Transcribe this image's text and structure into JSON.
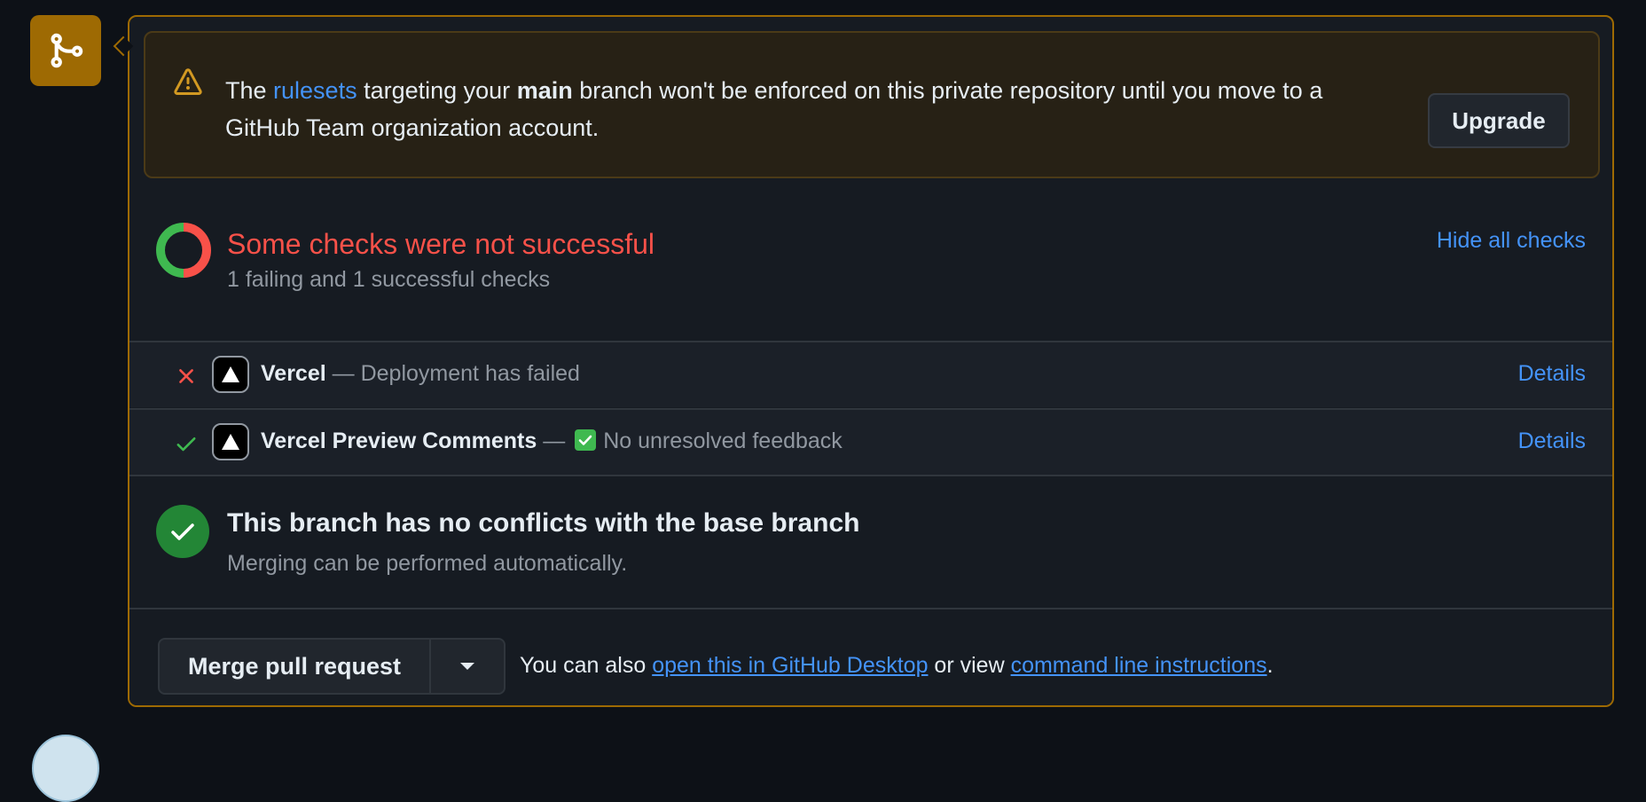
{
  "warning": {
    "text_prefix": "The ",
    "rulesets_link": "rulesets",
    "text_mid": " targeting your ",
    "branch": "main",
    "text_suffix": " branch won't be enforced on this private repository until you move to a GitHub Team organization account.",
    "upgrade_label": "Upgrade"
  },
  "checks": {
    "title": "Some checks were not successful",
    "subtitle": "1 failing and 1 successful checks",
    "hide_label": "Hide all checks",
    "rows": [
      {
        "status": "failed",
        "name": "Vercel",
        "separator": " — ",
        "description": "Deployment has failed",
        "details_label": "Details"
      },
      {
        "status": "success",
        "name": "Vercel Preview Comments",
        "separator": " — ",
        "description": "No unresolved feedback",
        "details_label": "Details"
      }
    ]
  },
  "conflicts": {
    "title": "This branch has no conflicts with the base branch",
    "subtitle": "Merging can be performed automatically."
  },
  "merge": {
    "button_label": "Merge pull request",
    "hint_prefix": "You can also ",
    "desktop_link": "open this in GitHub Desktop",
    "hint_mid": " or view ",
    "cli_link": "command line instructions",
    "hint_suffix": "."
  },
  "colors": {
    "accent_attention": "#9e6a03",
    "danger": "#f85149",
    "success": "#3fb950",
    "link": "#4493f8"
  },
  "icons": [
    "git-merge-icon",
    "alert-icon",
    "checks-donut-icon",
    "x-icon",
    "check-icon",
    "vercel-logo-icon",
    "check-circle-icon",
    "triangle-down-icon"
  ]
}
